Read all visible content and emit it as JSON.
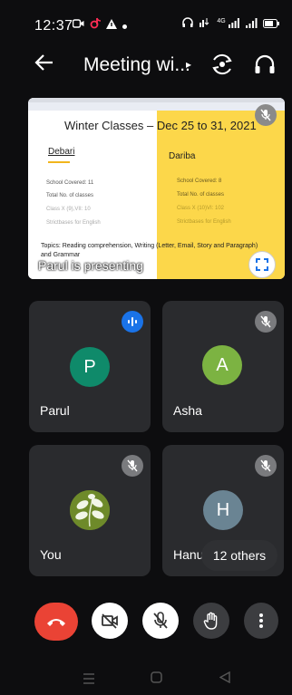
{
  "status_bar": {
    "time": "12:37",
    "left_icons": [
      "meet-notification-icon",
      "tiktok-icon",
      "warning-icon",
      "dot-icon"
    ],
    "right_icons": [
      "headphones-icon",
      "data-icon",
      "signal-4g-icon",
      "signal-icon",
      "battery-icon"
    ],
    "network_label": "4G"
  },
  "header": {
    "title": "Meeting wi...",
    "chevron": "▸"
  },
  "share": {
    "slide_title": "Winter Classes – Dec 25 to 31, 2021",
    "col_left_heading": "Debari",
    "col_right_heading": "Dariba",
    "left_items": [
      "School Covered: 11",
      "Total No. of classes",
      "Class X (9),VII: 10",
      "Strictbases for English"
    ],
    "right_items": [
      "School Covered: 8",
      "Total No. of classes",
      "Class X (10)VI: 102",
      "Strictbases for English"
    ],
    "topics": "Topics: Reading comprehension, Writing (Letter, Email, Story and Paragraph) and Grammar",
    "presenting_label": "Parul is presenting",
    "colors": {
      "left": "#ffffff",
      "right": "#fcd74a",
      "accent_line": "#f1b51c"
    }
  },
  "participants": [
    {
      "name": "Parul",
      "initial": "P",
      "avatar_color": "#0f8a6a",
      "badge": "speaking-icon"
    },
    {
      "name": "Asha",
      "initial": "A",
      "avatar_color": "#7cb342",
      "badge": "mic-off-icon"
    },
    {
      "name": "You",
      "initial": "",
      "avatar_color": "#6e8a2a",
      "badge": "mic-off-icon"
    },
    {
      "name": "Hanu",
      "initial": "H",
      "avatar_color": "#6a8493",
      "badge": "mic-off-icon"
    }
  ],
  "others_label": "12 others",
  "controls": [
    {
      "name": "end-call",
      "icon": "phone-hangup-icon",
      "color": "#ea4335"
    },
    {
      "name": "camera-off",
      "icon": "video-off-icon",
      "color": "#ffffff"
    },
    {
      "name": "mic-off",
      "icon": "mic-off-icon",
      "color": "#ffffff"
    },
    {
      "name": "raise-hand",
      "icon": "hand-icon",
      "color": "#3c3d40"
    },
    {
      "name": "more",
      "icon": "more-vertical-icon",
      "color": "#3c3d40"
    }
  ],
  "nav_bar": [
    "recents-icon",
    "home-icon",
    "back-icon"
  ]
}
